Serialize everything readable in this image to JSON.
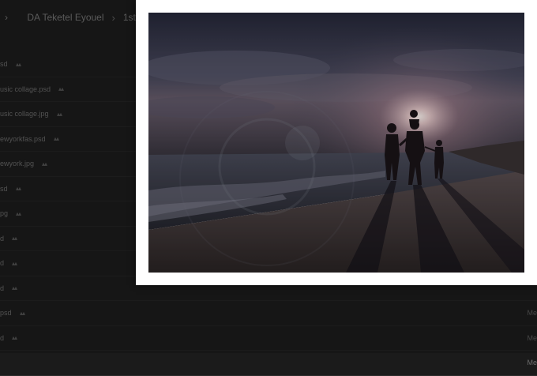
{
  "breadcrumb": {
    "lead_icon": "chevron-right-icon",
    "items": [
      "DA Teketel Eyouel",
      "1st Se"
    ],
    "separator_icon": "chevron-right-icon"
  },
  "files": [
    {
      "name": "sd",
      "share": "share-icon",
      "right": ""
    },
    {
      "name": "usic collage.psd",
      "share": "share-icon",
      "right": ""
    },
    {
      "name": "usic collage.jpg",
      "share": "share-icon",
      "right": ""
    },
    {
      "name": "ewyorkfas.psd",
      "share": "share-icon",
      "right": ""
    },
    {
      "name": "ewyork.jpg",
      "share": "share-icon",
      "right": ""
    },
    {
      "name": "sd",
      "share": "share-icon",
      "right": ""
    },
    {
      "name": "pg",
      "share": "share-icon",
      "right": ""
    },
    {
      "name": "d",
      "share": "share-icon",
      "right": ""
    },
    {
      "name": "d",
      "share": "share-icon",
      "right": ""
    },
    {
      "name": "d",
      "share": "share-icon",
      "right": ""
    },
    {
      "name": "psd",
      "share": "share-icon",
      "right": "Me"
    },
    {
      "name": "d",
      "share": "share-icon",
      "right": "Me"
    },
    {
      "name": "",
      "share": "",
      "right": "Me"
    }
  ],
  "lightbox": {
    "image_subject": "family-silhouette-beach-sunset"
  }
}
